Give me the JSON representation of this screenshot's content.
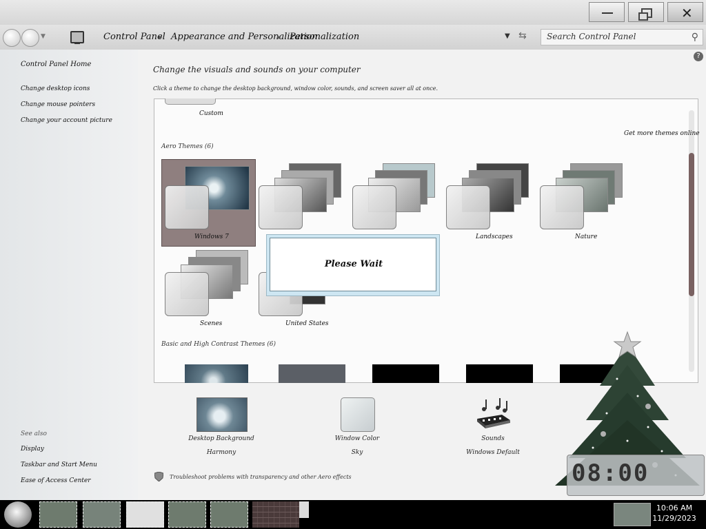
{
  "window": {
    "controls": {
      "minimize": "minimize-icon",
      "maximize": "restore-icon",
      "close": "close-icon"
    }
  },
  "addressbar": {
    "breadcrumbs": [
      "Control Panel",
      "Appearance and Personalization",
      "Personalization"
    ],
    "search_placeholder": "Search Control Panel"
  },
  "sidebar": {
    "home": "Control Panel Home",
    "links": [
      "Change desktop icons",
      "Change mouse pointers",
      "Change your account picture"
    ],
    "see_also_heading": "See also",
    "see_also": [
      "Display",
      "Taskbar and Start Menu",
      "Ease of Access Center"
    ]
  },
  "main": {
    "title": "Change the visuals and sounds on your computer",
    "description": "Click a theme to change the desktop background, window color, sounds, and screen saver all at once.",
    "custom_theme_label": "Custom",
    "get_more_link": "Get more themes online",
    "aero_heading": "Aero Themes (6)",
    "aero_themes": [
      "Windows 7",
      "",
      "",
      "Landscapes",
      "Nature",
      "Scenes",
      "United States"
    ],
    "basic_heading": "Basic and High Contrast Themes (6)",
    "dialog_text": "Please Wait"
  },
  "bottom": {
    "desktop_background": {
      "label": "Desktop Background",
      "value": "Harmony"
    },
    "window_color": {
      "label": "Window Color",
      "value": "Sky"
    },
    "sounds": {
      "label": "Sounds",
      "value": "Windows Default"
    },
    "troubleshoot": "Troubleshoot problems with transparency and other Aero effects"
  },
  "taskbar": {
    "time": "10:06 AM",
    "date": "11/29/2023"
  },
  "colors": {
    "selected_theme": "#8f7f7f",
    "scroll_thumb": "#7a6262",
    "taskbar": "#000000"
  }
}
